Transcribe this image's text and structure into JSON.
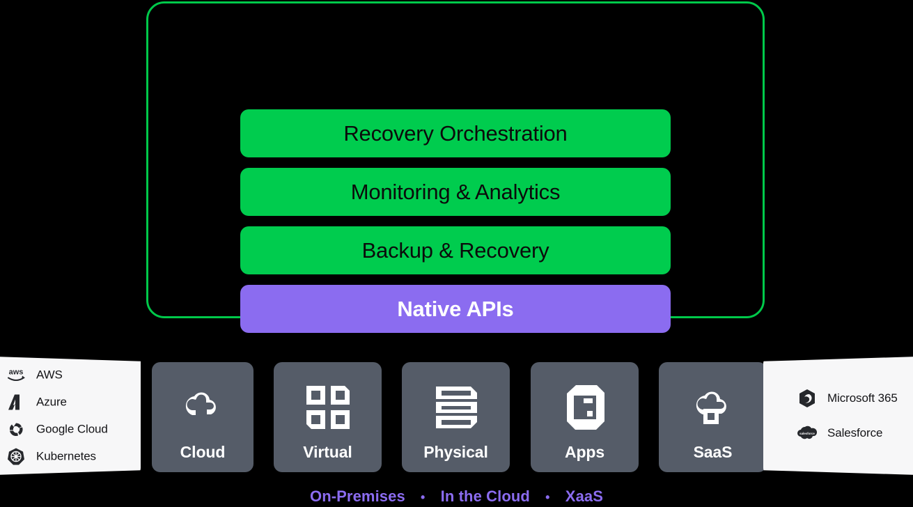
{
  "frame": {
    "border_color": "#00c94a"
  },
  "capabilities": {
    "items": [
      {
        "label": "Recovery Orchestration",
        "style": "green",
        "bg": "#00cc4e",
        "fg": "#0b0b0b"
      },
      {
        "label": "Monitoring & Analytics",
        "style": "green",
        "bg": "#00cc4e",
        "fg": "#0b0b0b"
      },
      {
        "label": "Backup & Recovery",
        "style": "green",
        "bg": "#00cc4e",
        "fg": "#0b0b0b"
      },
      {
        "label": "Native APIs",
        "style": "purple",
        "bg": "#8b6cf0",
        "fg": "#ffffff"
      }
    ]
  },
  "workloads": {
    "card_color": "#555c68",
    "items": [
      {
        "label": "Cloud",
        "icon": "cloud-icon"
      },
      {
        "label": "Virtual",
        "icon": "grid-squares-icon"
      },
      {
        "label": "Physical",
        "icon": "server-stack-icon"
      },
      {
        "label": "Apps",
        "icon": "app-document-icon"
      },
      {
        "label": "SaaS",
        "icon": "cloud-square-icon"
      }
    ]
  },
  "left_panel": {
    "items": [
      {
        "label": "AWS",
        "icon": "aws-logo-icon"
      },
      {
        "label": "Azure",
        "icon": "azure-logo-icon"
      },
      {
        "label": "Google Cloud",
        "icon": "google-cloud-logo-icon"
      },
      {
        "label": "Kubernetes",
        "icon": "kubernetes-logo-icon"
      }
    ]
  },
  "right_panel": {
    "items": [
      {
        "label": "Microsoft 365",
        "icon": "microsoft-365-logo-icon"
      },
      {
        "label": "Salesforce",
        "icon": "salesforce-logo-icon"
      }
    ]
  },
  "tagline": {
    "color": "#8b6cf0",
    "separator": "•",
    "modes": [
      "On-Premises",
      "In the Cloud",
      "XaaS"
    ]
  }
}
